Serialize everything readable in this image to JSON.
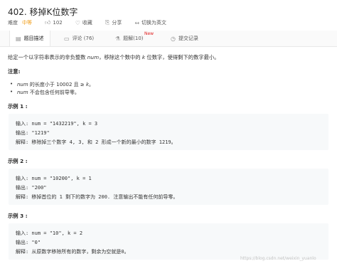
{
  "problem": {
    "title": "402. 移掉K位数字"
  },
  "meta": {
    "difficulty_label": "难度",
    "difficulty_value": "中等",
    "likes": "102",
    "favorite_label": "收藏",
    "share_label": "分享",
    "translate_label": "切换为英文"
  },
  "tabs": {
    "description": "题目描述",
    "comments": "评论 (76)",
    "solutions": "题解(10)",
    "new_badge": "New",
    "submissions": "提交记录"
  },
  "content": {
    "intro_prefix": "给定一个以字符串表示的非负整数 ",
    "intro_num": "num",
    "intro_mid": "，移除这个数中的 ",
    "intro_k": "k",
    "intro_suffix": " 位数字，使得剩下的数字最小。",
    "note_title": "注意:",
    "notes": [
      {
        "var": "num",
        "text": " 的长度小于 10002 且 ≥ ",
        "var2": "k",
        "tail": "。"
      },
      {
        "var": "num",
        "text": " 不会包含任何前导零。"
      }
    ],
    "examples": [
      {
        "title": "示例 1 :",
        "input": "输入: num = \"1432219\", k = 3",
        "output": "输出: \"1219\"",
        "explain": "解释: 移除掉三个数字 4, 3, 和 2 形成一个新的最小的数字 1219。"
      },
      {
        "title": "示例 2 :",
        "input": "输入: num = \"10200\", k = 1",
        "output": "输出: \"200\"",
        "explain": "解释: 移掉首位的 1 剩下的数字为 200. 注意输出不能有任何前导零。"
      },
      {
        "title": "示例 3 :",
        "input": "输入: num = \"10\", k = 2",
        "output": "输出: \"0\"",
        "explain": "解释: 从原数字移除所有的数字，剩余为空就是0。"
      }
    ]
  },
  "watermark": "https://blog.csdn.net/weixin_yuanlo"
}
